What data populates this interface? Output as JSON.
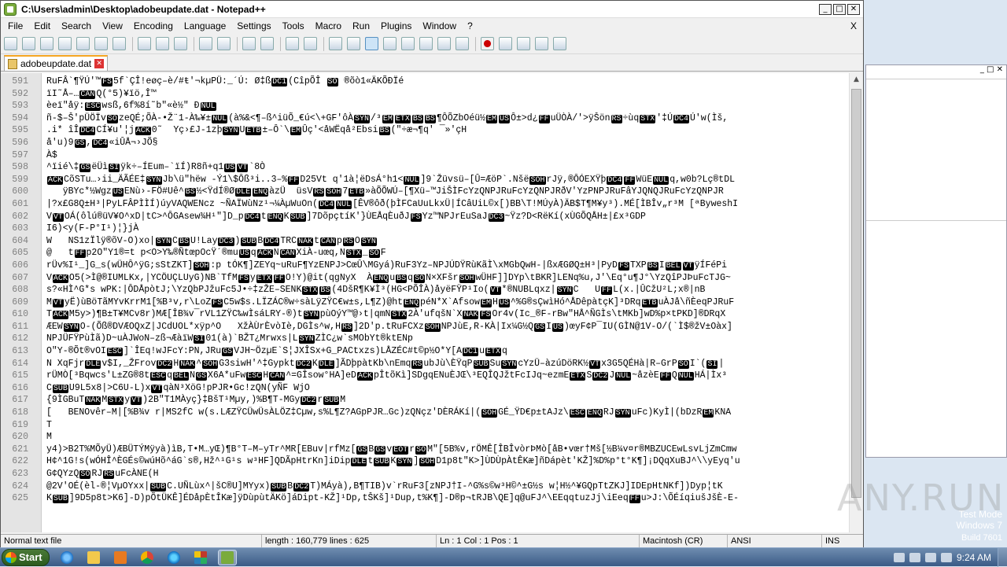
{
  "window": {
    "title": "C:\\Users\\admin\\Desktop\\adobeupdate.dat - Notepad++"
  },
  "menu": [
    "File",
    "Edit",
    "Search",
    "View",
    "Encoding",
    "Language",
    "Settings",
    "Tools",
    "Macro",
    "Run",
    "Plugins",
    "Window",
    "?"
  ],
  "menu_close": "X",
  "tab": {
    "label": "adobeupdate.dat"
  },
  "lines": [
    {
      "n": "591",
      "text": "RuFÂ`¶ŸÚ'™FS5f`ÇÎ!eøç–è/#ŧ'¬kµPÜ:_´Ú: Ø‡ßDC1(CîpÕÎ SO ®õò1«ÄKÕÐÏé"
    },
    {
      "n": "592",
      "text": "ïI˜Å–…CANQ(°5)¥ïö‚Î™"
    },
    {
      "n": "593",
      "text": "èeï\"åÿ:ESCwsß,6f%8í˜b\"«è½\" ÐNUL"
    },
    {
      "n": "594",
      "text": "ñ-$–Š'pÜÖÏvSOzeQÉ;ÕÀ-•Ž¨1-À‰¥±NUL(à%&<¶–ß^iüÕ_€ú<\\+GF'ôÀSYN/³EMETXBSBS¶ÔÕZbOéü½EMUSÔ±>d¿FFuÜÒÀ/'>ÿŠönRS÷ùqSTX'‡ÚDC4Ú'w(Ìš,"
    },
    {
      "n": "595",
      "text": ".i* îÎDC4CÍ¥u'¦jACK0˜  Yç›£J-1zþSYNUETB±–Ô`\\EMÛç'<åWËqå²EbsiBS(\"÷æ¬¶q' ¯»'çH"
    },
    {
      "n": "596",
      "text": "å'u)9GS,DC4«iÛÅ¬›JÕ§"
    },
    {
      "n": "597",
      "text": "À$"
    },
    {
      "n": "598",
      "text": "^ïié\\‡GSëÜìSIÿk÷–ÍEum–`ïÍ)R8ñ+q1USVT`8Ò"
    },
    {
      "n": "599",
      "text": "ACKCõSTu…›ii_ÄÃÉE‡SYNJb\\ü\"hëw -Ý1\\$Ôß³i..3–%FFD25Vt q'1à¦ëDsÁ°h1<NUL]9`Žüvsü–[Û=ÆöP`.NšëSOHrJÿ,®ÔÓEXŸþDC4FFWüENULq,w0b?Lç®tDL"
    },
    {
      "n": "600",
      "text": "   ÿBYc*½WgzUSENù›-FÖ#Uê^BS½<ŸdÍ®ØDLEENQàzÜ  üsVRSSOH7ETB»àÕÕWÚ–[¶Xü–™JiŠÌFcYzQNPJRuFcYzQNPJRðV'YzPNPJRuFâYJQNQJRuFcYzQNPJR"
    },
    {
      "n": "601",
      "text": "|?x£G8Q±H³|PyLFÂPÌÌÍ)úyVAQWENcz ~ÑAÏWùNz¹¬¼ÀµWuOn(DC4NUL[ÊV®ôð(þÌFCaUuLkxÜ|ÍCâUiL©x[)BB\\T!MÚyÀ)ÄB$T¶M¥y³).MÉ[ÌBÎv„r³M [ªByweshI"
    },
    {
      "n": "602",
      "text": "VVTOÁ(ôlú®üV¥O^xD|tC>^ÔGAsew¾H¹\"]D_pDC4tENQKSUB]7DõpçtíK'}ÙEÅqÈuðJFSYz™NPJrEuSaJDC3~Ÿz?D<RëKí(xÙGÕQÅH±|£x³GDP"
    },
    {
      "n": "603",
      "text": "I6)<y(F-P°I¹)¦}jÀ"
    },
    {
      "n": "604",
      "text": "W   NS1zÏlÿ®õV-O)xo|SYNCBSU!LayDC3)SUBBDC4TRCNAKtCANpRSOSYN"
    },
    {
      "n": "605",
      "text": "@   tFFp2O\"Y1®=t p<O>Y‰®ÑtœpOcŸ´®muUSqACKNCANXiÀ-uœq,NSTX_SOF"
    },
    {
      "n": "606",
      "text": "rÜv%I¹_]G_s(wÜHÔ^ÿG;sStZKT]SOH:p tÓK¶]ZEYq~uRuF¶YzENPJ>CœÛ\\MGyá)RuF3Yz–NPJÚDŸRùKãÌ\\xMGbQwH-|ßxÆGØQ±H³|PyDFSTXPBSIBELVTÿÍFéPi"
    },
    {
      "n": "607",
      "text": "VACKO5(>Ì@®IUMLKx,|YCÖUÇLUyG)NB`TfMFSyETXFFO!Y)@it(qgNyX  ÀENQuBSqSON×XFšrSOHwÜHF]]DYp\\tBKR]LENq%u,J'\\Eq°u¶J°\\YzQîPJÞuFcTJG~"
    },
    {
      "n": "608",
      "text": "s?«HÌ^G*s wPK:|ÔDÅpòtJ;\\YzQbPJžuFc5J•÷‡zŽE–SENKSTXBS(4DšR¶K¥Ì³(HG<PÕÎÀ)åyëFŸP¹Io(VT*®NUBLqxz|SYNC   UFFL(x.|ÛCžU²L;x®|nB"
    },
    {
      "n": "609",
      "text": "MVTyË)ùBöTãMYvKrrM1[%B³v,r\\LoZFSC5w$s.LÏZÁC®w÷sàLÿZŸC€w±s,L¶Z)@htENQpéN*X`AfsowEMHUS^%G®sÇwìHó^ÅDêpàtçK]³DRqETBuÀJå\\ñÈeqPJRuF"
    },
    {
      "n": "610",
      "text": "TACKM5y>)¶B±T¥MCv8r)MÆ[ÎB¾v¯rVL1ZŸC‰wÌsáLRY-®)tSYNpùOýY™@›t|qmNSTX2À'ufqšN`XNAKFSOr4v(Ic_®F-rBw\"HÅ^ÑGÌs\\tMKb]wD%p×tPKD]®DRqX"
    },
    {
      "n": "611",
      "text": "ÆEWSYNO-(Õß®DVÆOQxZ|JCdUOL*xÿp^O   XžÀÙrÈvòIè,DGÌs^w,HRS]2D'p.tRuFCXzSOHNPJùE,R-KÀ|Ix¼G½QGSIUS)œyF¢P¯IU(GÌN@1V-O/(`Ì$®žV±Oàx]"
    },
    {
      "n": "612",
      "text": "NPJÜFŸPùÌã)D~uÀJWoN–zß¬ÆàïWSI01(à)`BŽT¿Mrwxs|LSYNZÌC¿w`sMObYt®ktENp"
    },
    {
      "n": "613",
      "text": "O\"Y-®Õt®vOIESC]`ÎEq!wJFcY:PN,JRuGSVJH~ÖzµE`S¦JXÎSx+G_PACtxzs)LÅZÉC#t©p½O*Y[ADC1uETXq"
    },
    {
      "n": "614",
      "text": "N XqFjrDLEv$I,_ŽFrovDC2HNAK^SOHG3siwH'^‡GypktDC2KDLE]ÃDþpàtKb\\nEmqRSubJù\\ÈŸqPSUBSuSYNcYzÜ–àzúDöRK½VTx3G5QÉHà|R–GrPSOI`(SI|"
    },
    {
      "n": "615",
      "text": "rÜMÒ[³Bqwcs'L±ZG®8tESCqBELNGSX6A*uFwESCHCAN^=GÎsow°HA]eDACKpÎtõKì]SDgqENuÈJŒ\\³EQÎQJžtFcIJq~ezmEETXSDC2JNUL~åzèEFFQNULHÁ|Ìx³"
    },
    {
      "n": "616",
      "text": "CSUBU9L5x8|>C6U-L)xVTqàN³XöG!pPJR•Gc!zQN(yÑF WjO"
    },
    {
      "n": "617",
      "text": "{9ÌGBuTNAKMSTXyVT)2B\"T1MÀyç}‡BšT¹Mµy,)%B¶T-MGyDC2rSUBM"
    },
    {
      "n": "618",
      "text": "[   BENOvêr–M|[%B¾v r|MS2fC w(s.LÆZŸCÜwÜsÀLÖZ‡Cµw,s%L¶Z?AGpPJR…Gc)zQNçz'DÈRÁKí|(SOHGÉ_ŸD€p±tAJz\\ESCENQRJSYNuFc)KyÌ|(bDzREMKNA"
    },
    {
      "n": "619",
      "text": "T"
    },
    {
      "n": "620",
      "text": "M"
    },
    {
      "n": "621",
      "text": "y4)>B2T%MÕyÜ)ÆBÜTÝMÿyà)ìB,T•M…yŒ)¶B°T–M–yTr^MR[EBuv|rfMz[GSBGSvEOTrSOM\"[5B%v,rÖMÊ[ÎBÎvòrÞMò[åB•vœr†Mš[½B¼v¤r®MBZUCEwLsvLjZmCmw"
    },
    {
      "n": "622",
      "text": "H¢^1G!s(wÓHÎ^ÈGÉs©wúHõ^áG`s®,Hž^¹G¹s w³HF]QDÃpHtrKn]iDipDLEtSUBKSYN]SOHD1p8t\"K>]ÙDÙpÀtÊKæ]ñDápèt'KŽ]%D%p°t°K¶]¡DQqXuBJ^\\\\yEyq'u"
    },
    {
      "n": "623",
      "text": "G¢QYzQSORJRSuFcÀNE(H"
    },
    {
      "n": "624",
      "text": "@2V'OÉ(èl-®¦VµOYxx|SUBC.UÑLùx^|šC®U]MYyx)SUBBDC2T)MÁyà),B¶TIB)v`rRuF3[zNPJ†I-^G%s©w³H©^±G½s w¦H½^¥GQpTtZKJ]IDEpHtNKf])Dyp¦tK"
    },
    {
      "n": "625",
      "text": "KSUB]9D5p8t>K6]-D)pÕtÜKÊ]ÉDåpÈtÎKæ]ÿDùpùtÄKö]áDipt-KŽ]¹Dp,tŠKš]¹Dup,t%K¶]-D®p¬tRJB\\QE]q@uFJ^\\EEqqtuzJj\\iEeqFFu>J:\\ÕÉíqiušJšÈ-E-"
    }
  ],
  "status": {
    "type": "Normal text file",
    "length": "length : 160,779    lines : 625",
    "position": "Ln : 1    Col : 1    Pos : 1",
    "eol": "Macintosh (CR)",
    "encoding": "ANSI",
    "mode": "INS"
  },
  "watermark": "ANY.RUN",
  "os": {
    "line1": "Test Mode",
    "line2": "Windows 7",
    "line3": "Build 7601"
  },
  "taskbar": {
    "start": "Start",
    "clock": "9:24 AM"
  },
  "colors": {
    "tab_accent": "#f5a623",
    "taskbar": "#3a5a86",
    "control_char_bg": "#000000"
  }
}
